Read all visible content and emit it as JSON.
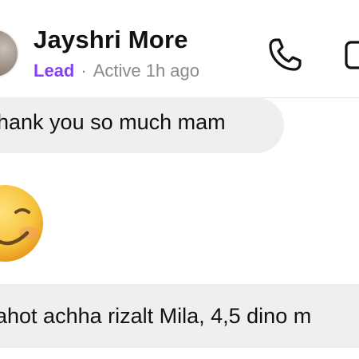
{
  "header": {
    "contact_name": "Jayshri More",
    "badge": "Lead",
    "separator": "·",
    "status": "Active 1h ago"
  },
  "messages": [
    {
      "text": "hank you so much mam"
    },
    {
      "emoji": "smiling-face-emoji"
    },
    {
      "text": "ahot achha rizalt Mila, 4,5 dino m"
    }
  ],
  "colors": {
    "badge": "#8b3dff",
    "bubble_bg": "#efefef",
    "status_text": "#8a8a8e",
    "emoji_face": "#f6c13a"
  },
  "icons": {
    "call": "phone-icon",
    "video": "video-camera-icon"
  }
}
